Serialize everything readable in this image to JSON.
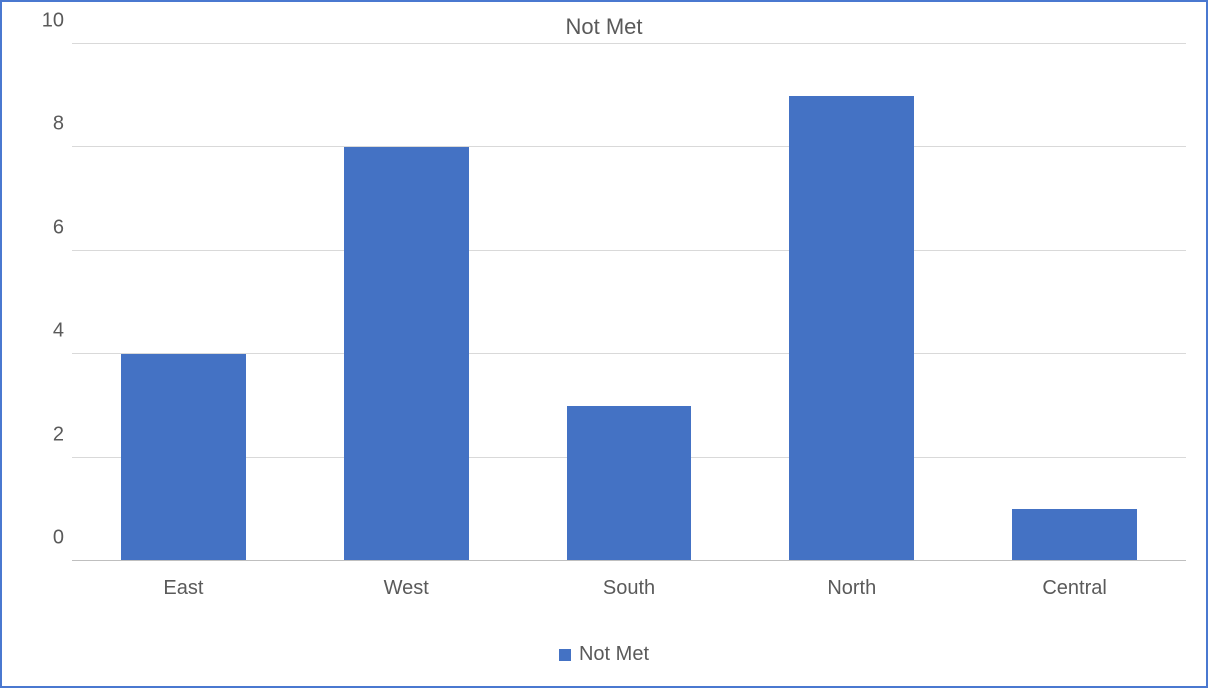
{
  "chart_data": {
    "type": "bar",
    "title": "Not Met",
    "categories": [
      "East",
      "West",
      "South",
      "North",
      "Central"
    ],
    "series": [
      {
        "name": "Not Met",
        "values": [
          4,
          8,
          3,
          9,
          1
        ]
      }
    ],
    "ylim": [
      0,
      10
    ],
    "y_ticks": [
      0,
      2,
      4,
      6,
      8,
      10
    ],
    "xlabel": "",
    "ylabel": "",
    "bar_color": "#4472c4",
    "gridline_color": "#d9d9d9",
    "legend_position": "bottom"
  }
}
